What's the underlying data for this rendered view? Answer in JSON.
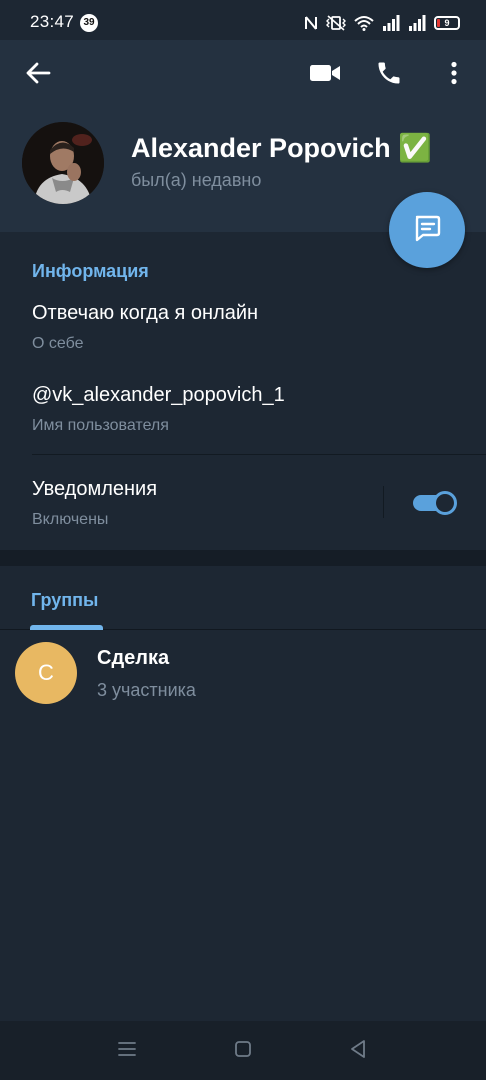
{
  "status_bar": {
    "time": "23:47",
    "notification_count": "39",
    "battery_level": "9",
    "icons": [
      "nfc-icon",
      "vibrate-icon",
      "wifi-icon",
      "signal-icon",
      "signal-icon",
      "battery-icon"
    ]
  },
  "header": {
    "back_icon": "arrow-left-icon",
    "video_icon": "video-camera-icon",
    "call_icon": "phone-icon",
    "more_icon": "more-vertical-icon",
    "name": "Alexander Popovich ✅",
    "status": "был(а) недавно",
    "message_fab_icon": "message-icon"
  },
  "info": {
    "section_title": "Информация",
    "bio": "Отвечаю когда я онлайн",
    "bio_label": "О себе",
    "username": "@vk_alexander_popovich_1",
    "username_label": "Имя пользователя",
    "notifications": "Уведомления",
    "notifications_status": "Включены",
    "notifications_enabled": true
  },
  "groups": {
    "tab_label": "Группы",
    "items": [
      {
        "initial": "C",
        "name": "Сделка",
        "members": "3 участника",
        "avatar_color": "#e8b862"
      }
    ]
  },
  "nav_bar": {
    "icons": [
      "menu-icon",
      "home-square-icon",
      "back-triangle-icon"
    ]
  },
  "colors": {
    "background": "#1d2733",
    "header": "#243140",
    "accent": "#5aa1dc",
    "link": "#71b5ec",
    "secondary_text": "#7f8e9e"
  }
}
